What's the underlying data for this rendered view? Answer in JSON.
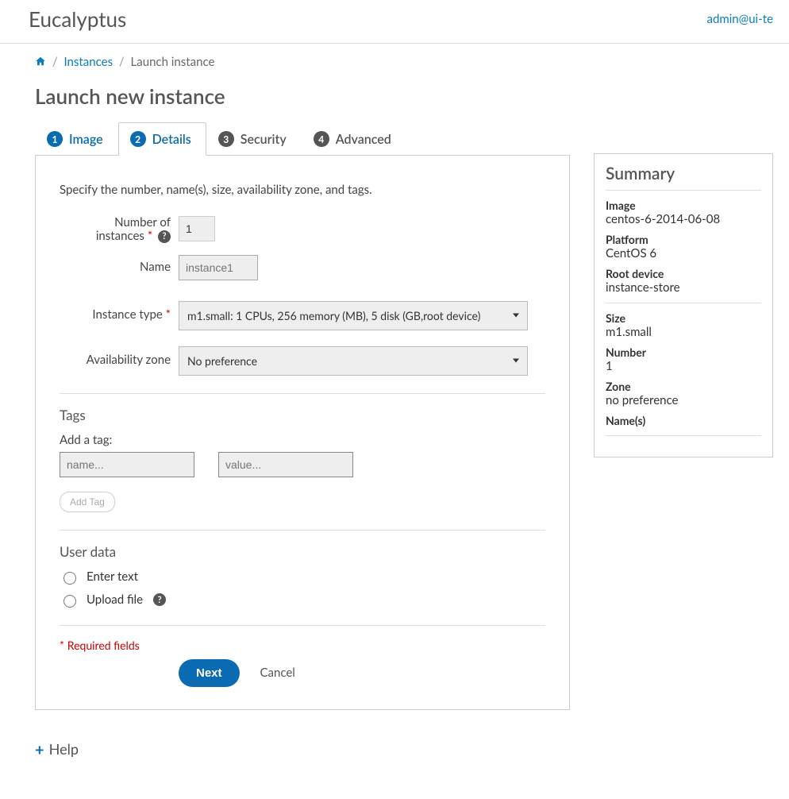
{
  "brand": "Eucalyptus",
  "user_link": "admin@ui-te",
  "breadcrumb": {
    "instances": "Instances",
    "current": "Launch instance"
  },
  "page_title": "Launch new instance",
  "tabs": [
    {
      "num": "1",
      "label": "Image"
    },
    {
      "num": "2",
      "label": "Details"
    },
    {
      "num": "3",
      "label": "Security"
    },
    {
      "num": "4",
      "label": "Advanced"
    }
  ],
  "intro": "Specify the number, name(s), size, availability zone, and tags.",
  "labels": {
    "num_instances_l1": "Number of",
    "num_instances_l2": "instances",
    "name": "Name",
    "instance_type": "Instance type",
    "availability_zone": "Availability zone"
  },
  "fields": {
    "num_instances_value": "1",
    "name_placeholder": "instance1",
    "instance_type_selected": "m1.small: 1 CPUs, 256 memory (MB), 5 disk (GB,root device)",
    "availability_zone_selected": "No preference"
  },
  "tags": {
    "heading": "Tags",
    "add_label": "Add a tag:",
    "name_placeholder": "name...",
    "value_placeholder": "value...",
    "add_btn": "Add Tag"
  },
  "userdata": {
    "heading": "User data",
    "enter_text": "Enter text",
    "upload_file": "Upload file"
  },
  "required_note_star": "*",
  "required_note_text": "Required fields",
  "next_btn": "Next",
  "cancel": "Cancel",
  "summary": {
    "title": "Summary",
    "image_k": "Image",
    "image_v": "centos-6-2014-06-08",
    "platform_k": "Platform",
    "platform_v": "CentOS 6",
    "rootdev_k": "Root device",
    "rootdev_v": "instance-store",
    "size_k": "Size",
    "size_v": "m1.small",
    "number_k": "Number",
    "number_v": "1",
    "zone_k": "Zone",
    "zone_v": "no preference",
    "names_k": "Name(s)"
  },
  "help_link": "Help"
}
